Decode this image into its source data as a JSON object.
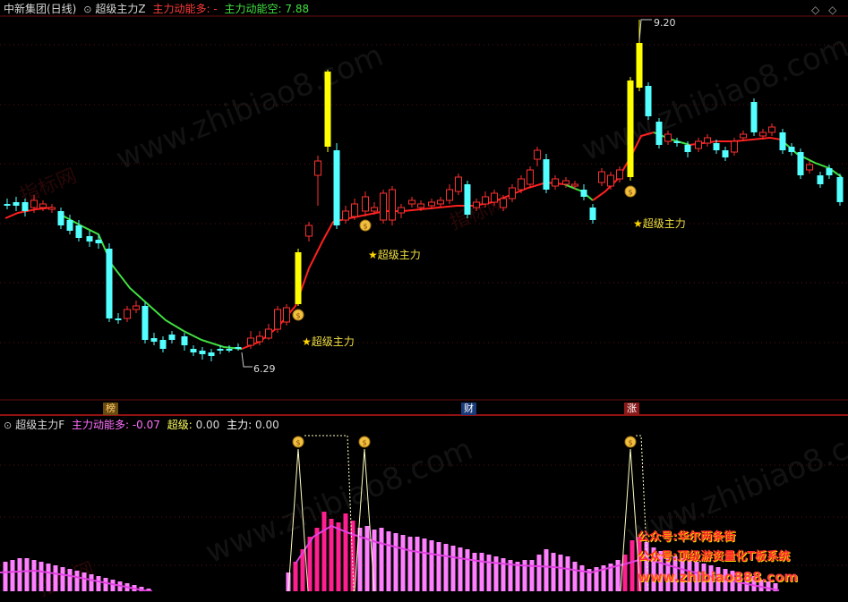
{
  "main_header": {
    "stock": "中新集团(日线)",
    "indicator": "超级主力Z",
    "long_label": "主力动能多:",
    "long_value": "-",
    "short_label": "主力动能空:",
    "short_value": "7.88"
  },
  "sub_header": {
    "indicator": "超级主力F",
    "long_label": "主力动能多:",
    "long_value": "-0.07",
    "chaoji_label": "超级:",
    "chaoji_value": "0.00",
    "zhuli_label": "主力:",
    "zhuli_value": "0.00"
  },
  "labels": {
    "high": "9.20",
    "low": "6.29",
    "signal_1": "超级主力",
    "signal_2": "超级主力",
    "signal_3": "超级主力",
    "star": "★"
  },
  "event_tags": [
    "榜",
    "财",
    "涨"
  ],
  "promo": {
    "line1": "公众号:华尔两条街",
    "line2": "公众号:顶级游资量化T板系统",
    "site": "www.zhibiao888.com"
  },
  "watermarks": {
    "site": "www.zhibiao8.com",
    "cn": "指标网"
  },
  "colors": {
    "up": "#ff3030",
    "down": "#54ffff",
    "strong": "#ffff00",
    "ma_up": "#ff2020",
    "ma_down": "#40e040",
    "sub_bar": "#ff80ff",
    "sub_bar_strong": "#ff1f8f",
    "divider": "#c01818"
  }
}
